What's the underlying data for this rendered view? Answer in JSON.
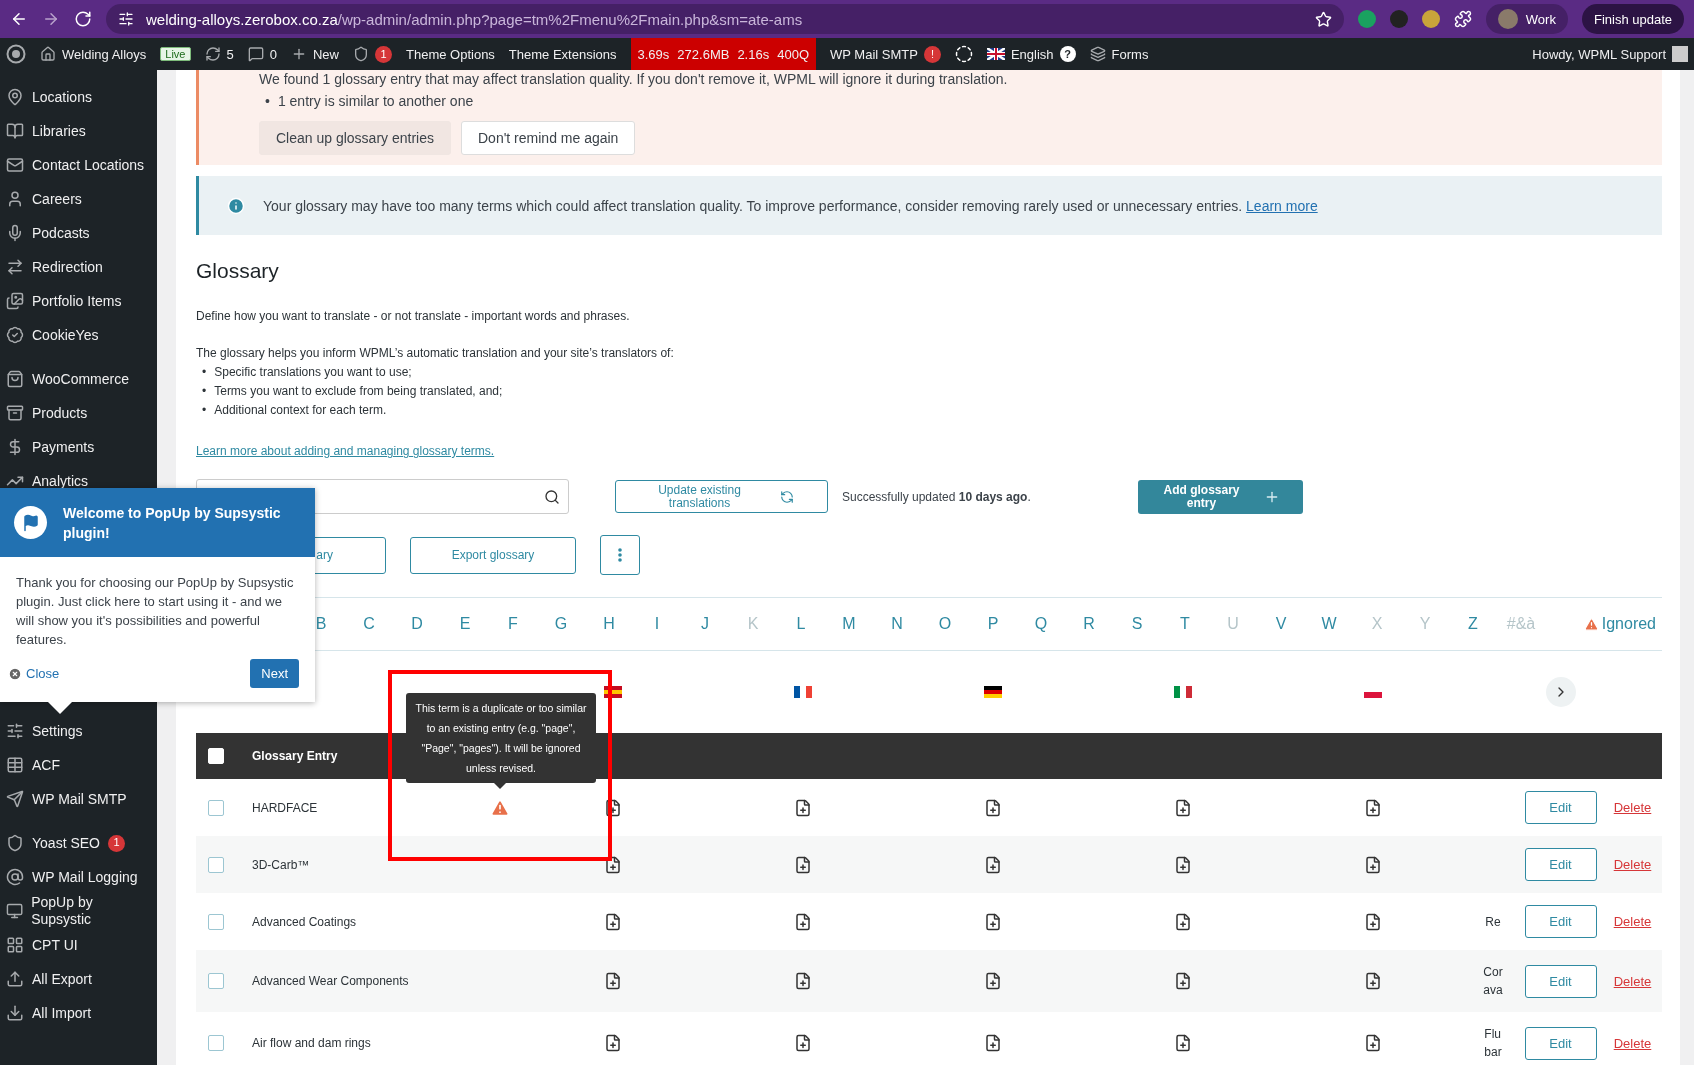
{
  "browser": {
    "url_domain": "welding-alloys.zerobox.co.za",
    "url_path": "/wp-admin/admin.php?page=tm%2Fmenu%2Fmain.php&sm=ate-ams",
    "profile": "Work",
    "update_button": "Finish update"
  },
  "admin_bar": {
    "site_name": "Welding Alloys",
    "live_badge": "Live",
    "updates": "5",
    "comments": "0",
    "new": "New",
    "yoast_badge": "1",
    "links": [
      "Theme Options",
      "Theme Extensions"
    ],
    "perf": [
      "3.69s",
      "272.6MB",
      "2.16s",
      "400Q"
    ],
    "smtp": "WP Mail SMTP",
    "smtp_badge": "!",
    "language": "English",
    "language_badge": "?",
    "forms": "Forms",
    "greeting": "Howdy, WPML Support"
  },
  "sidebar": {
    "groups_above": [
      [
        {
          "label": "Locations"
        },
        {
          "label": "Libraries"
        },
        {
          "label": "Contact Locations"
        },
        {
          "label": "Careers"
        },
        {
          "label": "Podcasts"
        },
        {
          "label": "Redirection"
        },
        {
          "label": "Portfolio Items"
        },
        {
          "label": "CookieYes"
        }
      ],
      [
        {
          "label": "WooCommerce"
        },
        {
          "label": "Products"
        },
        {
          "label": "Payments"
        },
        {
          "label": "Analytics"
        }
      ]
    ],
    "groups_below": [
      [
        {
          "label": "Settings"
        },
        {
          "label": "ACF"
        },
        {
          "label": "WP Mail SMTP"
        }
      ],
      [
        {
          "label": "Yoast SEO",
          "badge": "1"
        },
        {
          "label": "WP Mail Logging"
        },
        {
          "label": "PopUp by Supsystic"
        },
        {
          "label": "CPT UI"
        },
        {
          "label": "All Export"
        },
        {
          "label": "All Import"
        }
      ]
    ]
  },
  "popup": {
    "title": "Welcome to PopUp by Supsystic plugin!",
    "body": "Thank you for choosing our PopUp by Supsystic plugin. Just click here to start using it - and we will show you it's possibilities and powerful features.",
    "close": "Close",
    "next": "Next"
  },
  "warning_notice": {
    "text": "We found 1 glossary entry that may affect translation quality. If you don't remove it, WPML will ignore it during translation.",
    "bullets": [
      {
        "marker": "•",
        "text": "1 entry is similar to another one"
      }
    ],
    "buttons": [
      "Clean up glossary entries",
      "Don't remind me again"
    ]
  },
  "info_notice": {
    "text": "Your glossary may have too many terms which could affect translation quality. To improve performance, consider removing rarely used or unnecessary entries.",
    "link": "Learn more"
  },
  "glossary": {
    "title": "Glossary",
    "intro": "Define how you want to translate - or not translate - important words and phrases.",
    "lead": "The glossary helps you inform WPML’s automatic translation and your site’s translators of:",
    "bullets": [
      {
        "marker": "•",
        "text": "Specific translations you want to use;"
      },
      {
        "marker": "•",
        "text": "Terms you want to exclude from being translated, and;"
      },
      {
        "marker": "•",
        "text": "Additional context for each term."
      }
    ],
    "link": "Learn more about adding and managing glossary terms."
  },
  "toolbar": {
    "update_button": "Update existing translations",
    "status": "Successfully updated **10 days ago**.",
    "add_button": "Add glossary entry",
    "import_button": "ary",
    "export_button": "Export glossary"
  },
  "alphabet": {
    "letters": [
      {
        "label": "B",
        "disabled": false
      },
      {
        "label": "C",
        "disabled": false
      },
      {
        "label": "D",
        "disabled": false
      },
      {
        "label": "E",
        "disabled": false
      },
      {
        "label": "F",
        "disabled": false
      },
      {
        "label": "G",
        "disabled": false
      },
      {
        "label": "H",
        "disabled": false
      },
      {
        "label": "I",
        "disabled": false
      },
      {
        "label": "J",
        "disabled": false
      },
      {
        "label": "K",
        "disabled": true
      },
      {
        "label": "L",
        "disabled": false
      },
      {
        "label": "M",
        "disabled": false
      },
      {
        "label": "N",
        "disabled": false
      },
      {
        "label": "O",
        "disabled": false
      },
      {
        "label": "P",
        "disabled": false
      },
      {
        "label": "Q",
        "disabled": false
      },
      {
        "label": "R",
        "disabled": false
      },
      {
        "label": "S",
        "disabled": false
      },
      {
        "label": "T",
        "disabled": false
      },
      {
        "label": "U",
        "disabled": true
      },
      {
        "label": "V",
        "disabled": false
      },
      {
        "label": "W",
        "disabled": false
      },
      {
        "label": "X",
        "disabled": true
      },
      {
        "label": "Y",
        "disabled": true
      },
      {
        "label": "Z",
        "disabled": false
      },
      {
        "label": "#&à",
        "disabled": true
      }
    ],
    "ignored": "Ignored"
  },
  "table": {
    "select_all_checked": false,
    "columns": [
      "Glossary Entry"
    ],
    "rows": [
      {
        "entry": "HARDFACE",
        "checked": false,
        "ignored": true,
        "column_8": "",
        "edit": "Edit",
        "delete": "Delete"
      },
      {
        "entry": "3D-Carb™",
        "checked": false,
        "ignored": false,
        "column_8": "",
        "edit": "Edit",
        "delete": "Delete"
      },
      {
        "entry": "Advanced Coatings",
        "checked": false,
        "ignored": false,
        "column_8": "Re",
        "edit": "Edit",
        "delete": "Delete"
      },
      {
        "entry": "Advanced Wear Components",
        "checked": false,
        "ignored": false,
        "column_8": "Cor ava",
        "edit": "Edit",
        "delete": "Delete"
      },
      {
        "entry": "Air flow and dam rings",
        "checked": false,
        "ignored": false,
        "column_8": "Flu bar",
        "edit": "Edit",
        "delete": "Delete"
      }
    ]
  },
  "tooltip": {
    "text": "This term is a duplicate or too similar to an existing entry (e.g. \"page\", \"Page\", \"pages\"). It will be ignored unless revised."
  }
}
